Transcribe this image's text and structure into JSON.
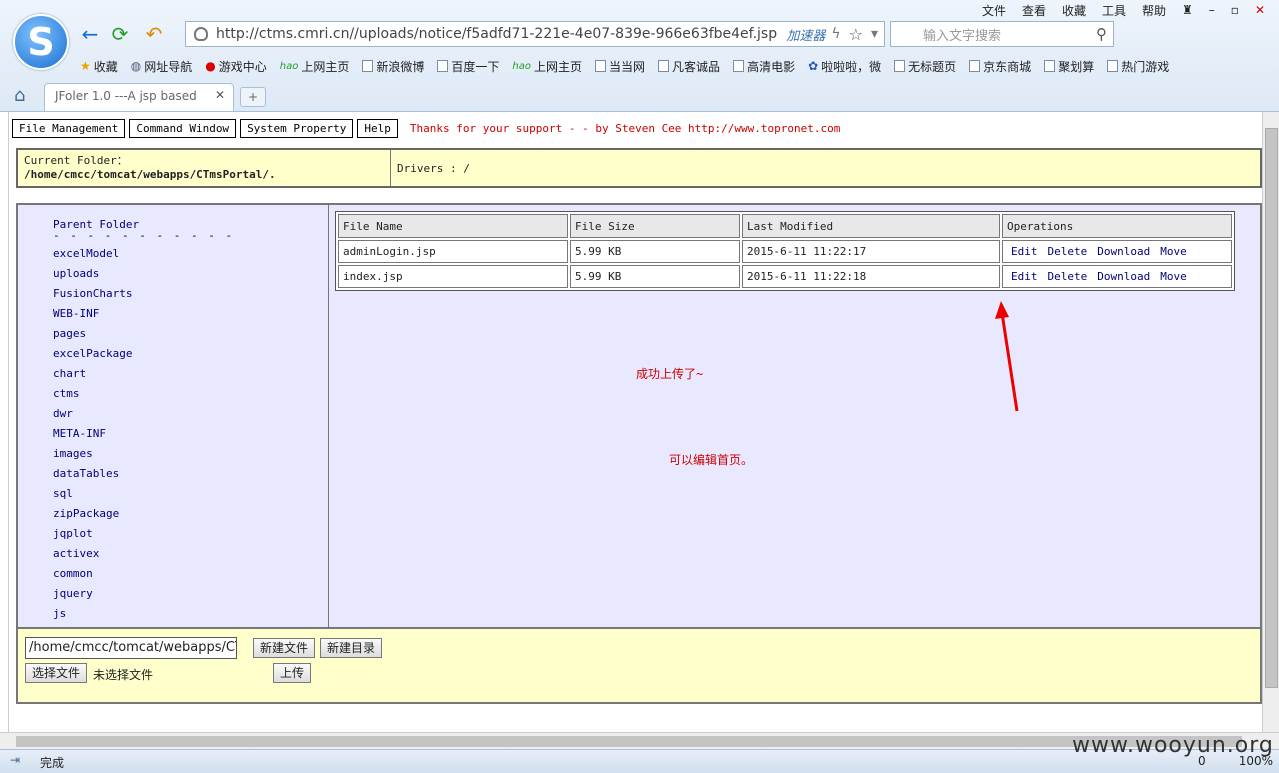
{
  "browser": {
    "menu": [
      "文件",
      "查看",
      "收藏",
      "工具",
      "帮助"
    ],
    "url": "http://ctms.cmri.cn//uploads/notice/f5adfd71-221e-4e07-839e-966e63fbe4ef.jsp",
    "accelerator": "加速器",
    "search_placeholder": "输入文字搜索",
    "bookmarks": [
      "收藏",
      "网址导航",
      "游戏中心",
      "上网主页",
      "新浪微博",
      "百度一下",
      "上网主页",
      "当当网",
      "凡客诚品",
      "高清电影",
      "啦啦啦，微",
      "无标题页",
      "京东商城",
      "聚划算",
      "热门游戏"
    ],
    "tab_title": "JFoler 1.0 ---A jsp based",
    "status_text": "完成",
    "zoom": "100%",
    "download_count": "0",
    "watermark": "www.wooyun.org"
  },
  "page": {
    "menu": [
      "File Management",
      "Command Window",
      "System Property",
      "Help"
    ],
    "thanks": "Thanks for your support - - by Steven Cee http://www.topronet.com",
    "current_folder_label": "Current Folder：",
    "current_folder": "/home/cmcc/tomcat/webapps/CTmsPortal/.",
    "drivers": "Drivers : /",
    "parent_folder": "Parent Folder",
    "separator": "- - - - - - - - - - -",
    "folders": [
      "excelModel",
      "uploads",
      "FusionCharts",
      "WEB-INF",
      "pages",
      "excelPackage",
      "chart",
      "ctms",
      "dwr",
      "META-INF",
      "images",
      "dataTables",
      "sql",
      "zipPackage",
      "jqplot",
      "activex",
      "common",
      "jquery",
      "js"
    ],
    "table_headers": [
      "File Name",
      "File Size",
      "Last Modified",
      "Operations"
    ],
    "files": [
      {
        "name": "adminLogin.jsp",
        "size": "5.99 KB",
        "modified": "2015-6-11 11:22:17"
      },
      {
        "name": "index.jsp",
        "size": "5.99 KB",
        "modified": "2015-6-11 11:22:18"
      }
    ],
    "operations": [
      "Edit",
      "Delete",
      "Download",
      "Move"
    ],
    "note1": "成功上传了~",
    "note2": "可以编辑首页。",
    "upload_path": "/home/cmcc/tomcat/webapps/CTmsP",
    "new_file_button": "新建文件",
    "new_dir_button": "新建目录",
    "choose_file_button": "选择文件",
    "no_file_text": "未选择文件",
    "upload_button": "上传"
  }
}
